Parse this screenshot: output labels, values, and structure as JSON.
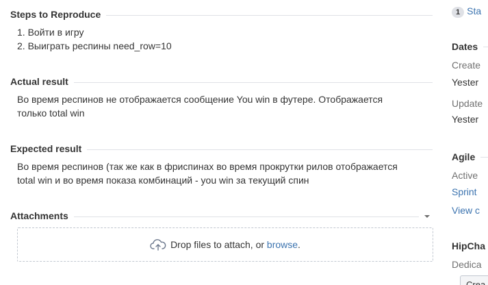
{
  "sections": {
    "steps": {
      "title": "Steps to Reproduce",
      "items": [
        "1. Войти в игру",
        "2. Выиграть респины need_row=10"
      ]
    },
    "actual": {
      "title": "Actual result",
      "lines": [
        "Во время респинов не отображается сообщение You win в футере. Отображается",
        "только total win"
      ]
    },
    "expected": {
      "title": "Expected result",
      "lines": [
        "Во время респинов (так же как в фриспинах во время прокрутки рилов отображается",
        "total win и во время показа комбинаций - you win за текущий спин"
      ]
    },
    "attachments": {
      "title": "Attachments",
      "drop_text": "Drop files to attach, or ",
      "browse_link": "browse",
      "drop_suffix": "."
    }
  },
  "sidebar": {
    "status_badge": "1",
    "status_link": "Sta",
    "dates": {
      "title": "Dates",
      "created_label": "Create",
      "created_value": "Yester",
      "updated_label": "Update",
      "updated_value": "Yester"
    },
    "agile": {
      "title": "Agile",
      "active_label": "Active",
      "sprint_link": "Sprint",
      "view_link": "View c"
    },
    "hipchat": {
      "title": "HipCha",
      "dedicated_label": "Dedica",
      "create_button": "Crea"
    }
  },
  "colors": {
    "link": "#3b73af",
    "rule": "#dfe1e6",
    "muted": "#707070"
  }
}
